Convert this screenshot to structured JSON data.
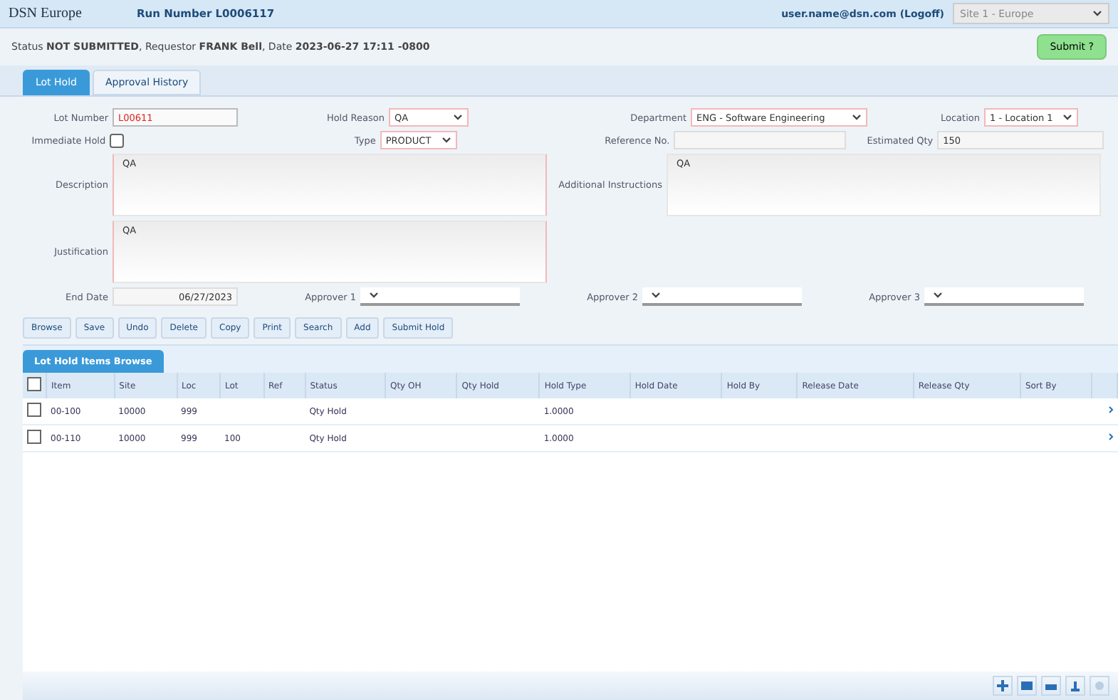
{
  "header": {
    "company": "DSN Europe",
    "run_number": "Run Number L0006117",
    "user": "user.name@dsn.com (Logoff)",
    "site_select": "Site 1 - Europe"
  },
  "status_line": "Status **NOT SUBMITTED**, Requestor **FRANK Bell**, Date **2023-06-27 17:11 -0800**",
  "submit_button": "Submit ?",
  "tabs": [
    {
      "label": "Lot Hold",
      "selected": true
    },
    {
      "label": "Approval History",
      "selected": false
    }
  ],
  "form": {
    "lot_number": {
      "label": "Lot Number",
      "value": "L00611"
    },
    "hold_reason": {
      "label": "Hold Reason",
      "value": "QA"
    },
    "department": {
      "label": "Department",
      "value": "ENG - Software Engineering"
    },
    "location": {
      "label": "Location",
      "value": "1 - Location 1"
    },
    "immediate_hold": {
      "label": "Immediate Hold",
      "checked": false
    },
    "type": {
      "label": "Type",
      "value": "PRODUCT"
    },
    "reference_no": {
      "label": "Reference No."
    },
    "estimated_qty": {
      "label": "Estimated Qty",
      "value": "150"
    },
    "description": {
      "label": "Description",
      "value": "QA"
    },
    "additional_instructions": {
      "label": "Additional Instructions",
      "value": "QA"
    },
    "justification": {
      "label": "Justification",
      "value": "QA"
    },
    "end_date": {
      "label": "End Date",
      "value": "06/27/2023"
    },
    "approvers": [
      {
        "label": "Approver 1"
      },
      {
        "label": "Approver 2"
      },
      {
        "label": "Approver 3"
      }
    ]
  },
  "toolbar": [
    "Browse",
    "Save",
    "Undo",
    "Delete",
    "Copy",
    "Print",
    "Search",
    "Add",
    "Submit Hold"
  ],
  "grid": {
    "tab": "Lot Hold Items Browse",
    "select_all": false,
    "columns": [
      "Item",
      "Site",
      "Loc",
      "Lot",
      "Ref",
      "Status",
      "Qty OH",
      "Qty Hold",
      "Hold Type",
      "Hold Date",
      "Hold By",
      "Release Date",
      "Release Qty",
      "Sort By"
    ],
    "rows": [
      {
        "selected": false,
        "cells": [
          "00-100",
          "10000",
          "999",
          "",
          "",
          "Qty Hold",
          "",
          "",
          "1.0000",
          "",
          "",
          "",
          "",
          ""
        ]
      },
      {
        "selected": false,
        "cells": [
          "00-110",
          "10000",
          "999",
          "100",
          "",
          "Qty Hold",
          "",
          "",
          "1.0000",
          "",
          "",
          "",
          "",
          ""
        ]
      }
    ]
  }
}
